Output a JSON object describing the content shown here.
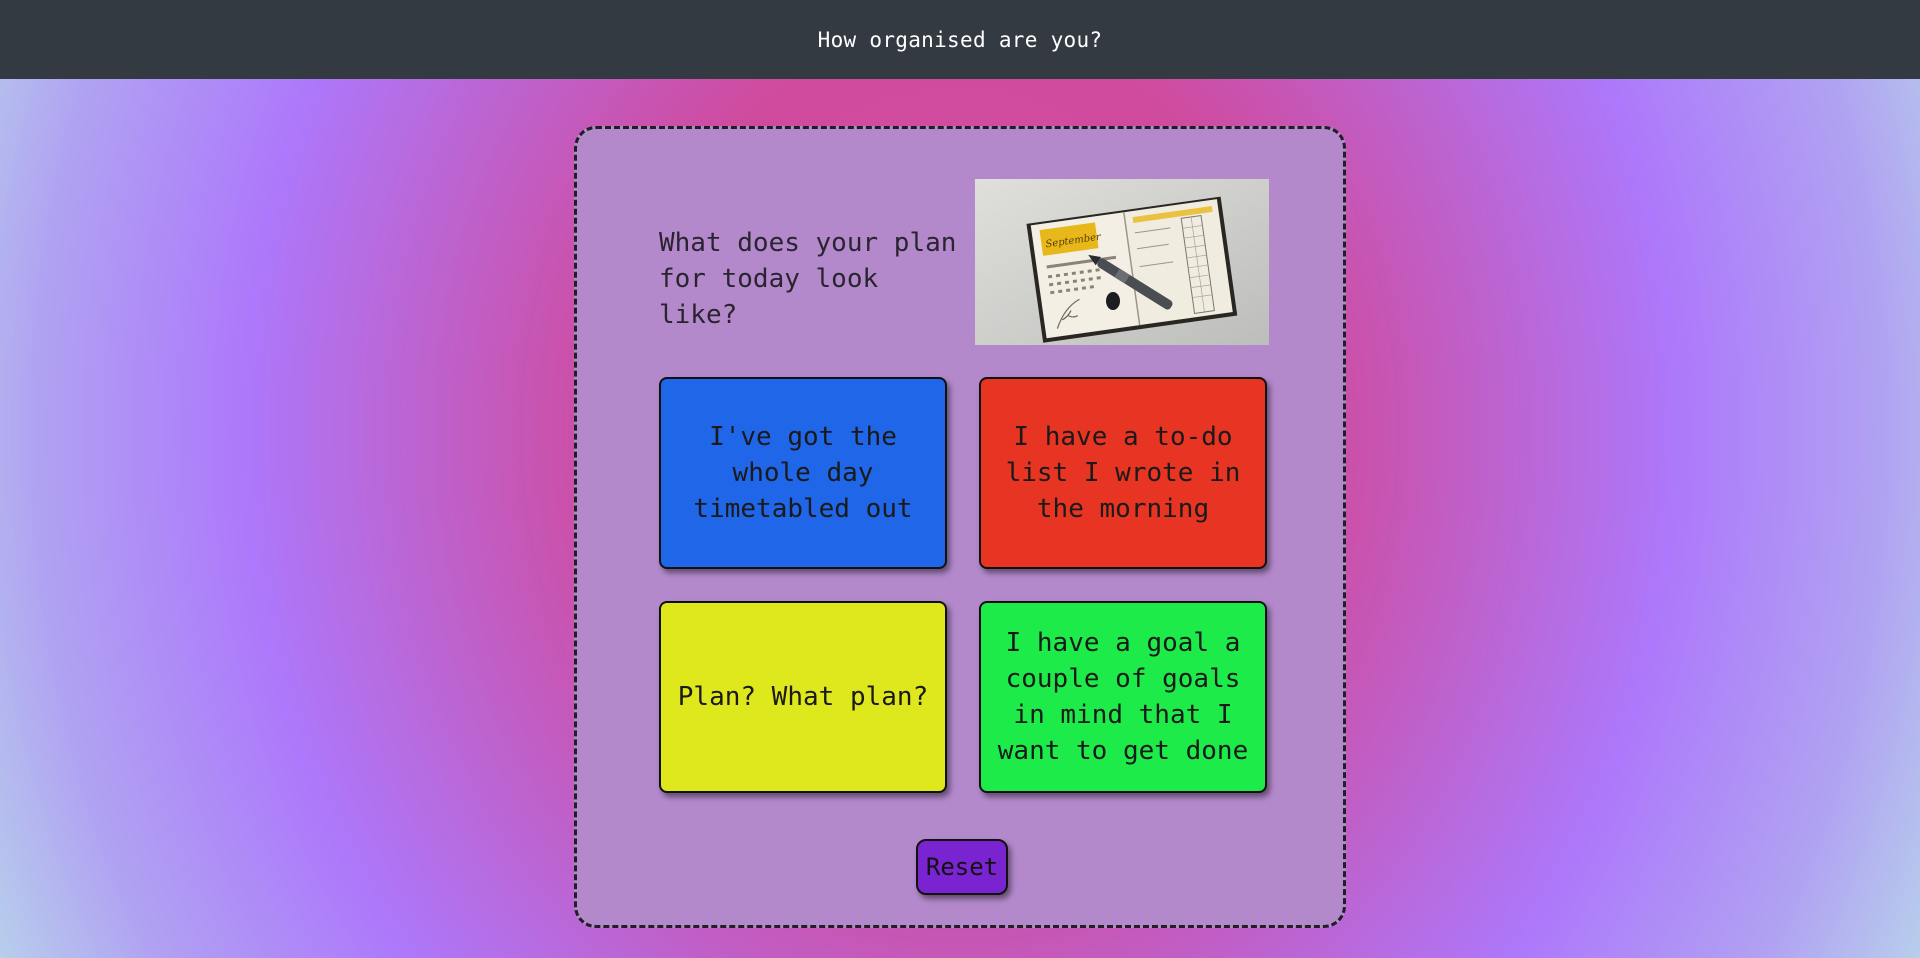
{
  "header": {
    "title": "How organised are you?"
  },
  "quiz": {
    "question": "What does your plan for today look like?",
    "image": {
      "subject": "open planner with September calendar and pen"
    },
    "answers": [
      {
        "label": "I've got the whole day timetabled out",
        "color": "#1f66e8"
      },
      {
        "label": "I have a to-do list I wrote in the morning",
        "color": "#e83422"
      },
      {
        "label": "Plan? What plan?",
        "color": "#dfe81c"
      },
      {
        "label": "I have a goal a couple of goals in mind that I want to get done",
        "color": "#1deb4a"
      }
    ],
    "reset": {
      "label": "Reset",
      "color": "#7a24d1"
    }
  },
  "colors": {
    "header_bg": "#343a42",
    "card_bg": "#b389cc"
  }
}
